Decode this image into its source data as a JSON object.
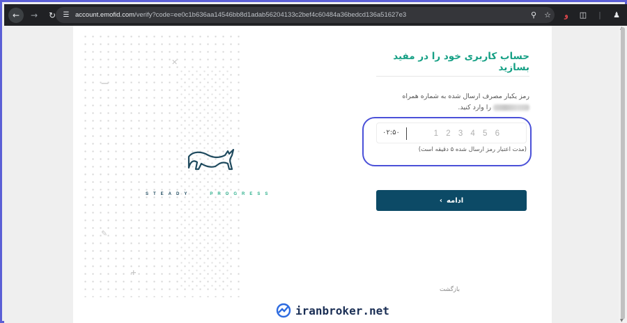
{
  "browser": {
    "url_host": "account.emofid.com",
    "url_rest": "/verify?code=ee0c1b636aa14546bb8d1adab56204133c2bef4c60484a36bedcd136a51627e3",
    "ext_badge": "و"
  },
  "left": {
    "tagline_word1": "STEADY",
    "tagline_word2": "PROGRESS"
  },
  "form": {
    "title": "حساب کاربری خود را در مفید بسازید",
    "desc_line1": "رمز یکبار مصرف ارسال شده به شماره همراه",
    "desc_line2": "را وارد کنید.",
    "timer": "۰۲:۵۰",
    "otp_placeholder": "1 2 3 4 5 6",
    "validity": "(مدت اعتبار رمز ارسال شده ۵ دقیقه است)",
    "continue_label": "ادامه",
    "back_label": "بازگشت"
  },
  "watermark": {
    "text": "iranbroker.net"
  },
  "colors": {
    "accent_teal": "#16a085",
    "button_navy": "#0c4a66",
    "highlight_ring": "#4a50d8"
  }
}
